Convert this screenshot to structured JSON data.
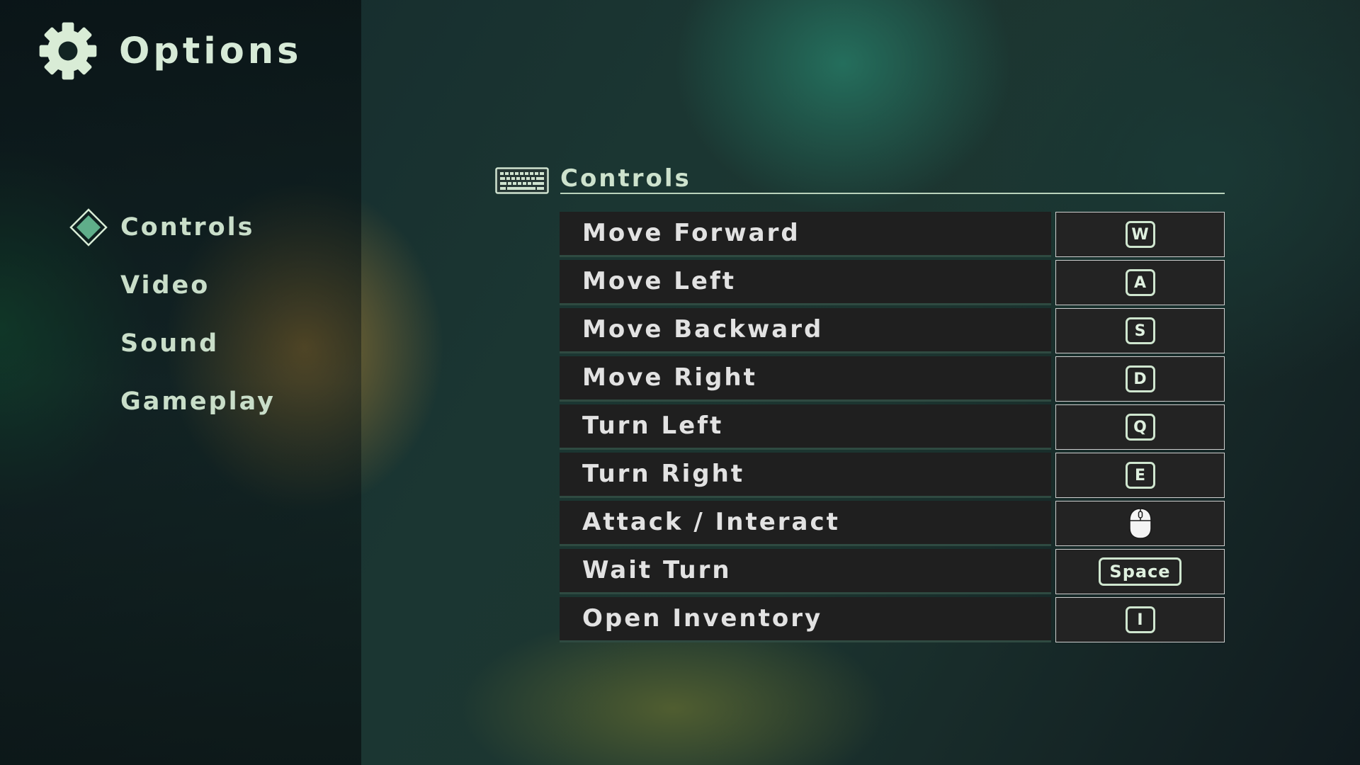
{
  "header": {
    "title": "Options",
    "icon": "gear-icon"
  },
  "sidebar": {
    "items": [
      {
        "label": "Controls",
        "selected": true
      },
      {
        "label": "Video",
        "selected": false
      },
      {
        "label": "Sound",
        "selected": false
      },
      {
        "label": "Gameplay",
        "selected": false
      }
    ]
  },
  "section": {
    "title": "Controls",
    "icon": "keyboard-icon"
  },
  "bindings": [
    {
      "action": "Move Forward",
      "key": "W"
    },
    {
      "action": "Move Left",
      "key": "A"
    },
    {
      "action": "Move Backward",
      "key": "S"
    },
    {
      "action": "Move Right",
      "key": "D"
    },
    {
      "action": "Turn Left",
      "key": "Q"
    },
    {
      "action": "Turn Right",
      "key": "E"
    },
    {
      "action": "Attack / Interact",
      "key": "",
      "key_icon": "left-mouse-button-icon"
    },
    {
      "action": "Wait Turn",
      "key": "Space"
    },
    {
      "action": "Open Inventory",
      "key": "I"
    }
  ],
  "colors": {
    "accent": "#5fae8a",
    "text_light": "#d7ead7",
    "row_background": "#1f1f1f",
    "key_border": "#cfe6cf"
  }
}
